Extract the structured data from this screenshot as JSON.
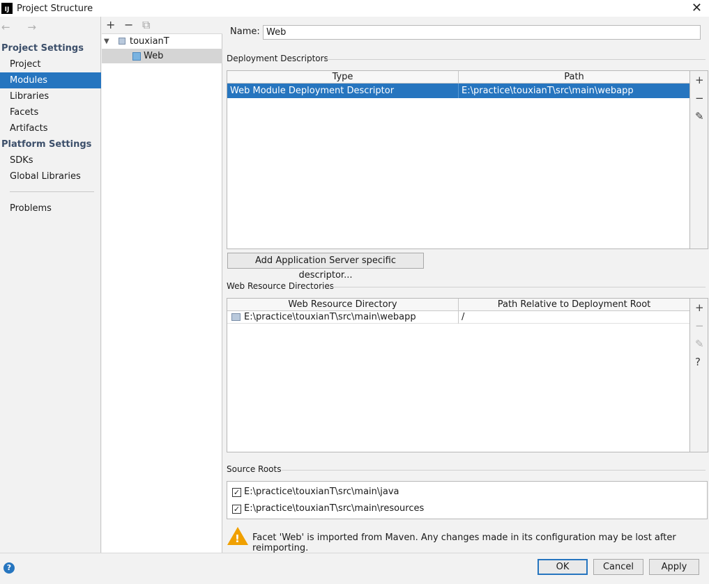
{
  "window": {
    "title": "Project Structure",
    "app_icon": "IJ"
  },
  "nav": {
    "back_forward": "← →",
    "project_settings_header": "Project Settings",
    "project_settings_items": [
      "Project",
      "Modules",
      "Libraries",
      "Facets",
      "Artifacts"
    ],
    "selected_item": "Modules",
    "platform_settings_header": "Platform Settings",
    "platform_settings_items": [
      "SDKs",
      "Global Libraries"
    ],
    "problems": "Problems"
  },
  "tree": {
    "toolbar": {
      "add": "+",
      "remove": "−",
      "copy": "⧉"
    },
    "root": "touxianT",
    "child": "Web"
  },
  "module": {
    "name_label": "Name:",
    "name_value": "Web",
    "deployment_descriptors_title": "Deployment Descriptors",
    "dd_columns": [
      "Type",
      "Path"
    ],
    "dd_rows": [
      [
        "Web Module Deployment Descriptor",
        "E:\\practice\\touxianT\\src\\main\\webapp"
      ]
    ],
    "add_server_descriptor_button": "Add Application Server specific descriptor...",
    "web_resource_title": "Web Resource Directories",
    "wr_columns": [
      "Web Resource Directory",
      "Path Relative to Deployment Root"
    ],
    "wr_rows": [
      [
        "E:\\practice\\touxianT\\src\\main\\webapp",
        "/"
      ]
    ],
    "source_roots_title": "Source Roots",
    "source_roots": [
      {
        "path": "E:\\practice\\touxianT\\src\\main\\java",
        "checked": true
      },
      {
        "path": "E:\\practice\\touxianT\\src\\main\\resources",
        "checked": true
      }
    ],
    "warning": "Facet 'Web' is imported from Maven. Any changes made in its configuration may be lost after reimporting."
  },
  "side_buttons": {
    "add": "+",
    "remove": "−",
    "edit": "✎",
    "help": "?"
  },
  "footer": {
    "help": "?",
    "ok": "OK",
    "cancel": "Cancel",
    "apply": "Apply"
  },
  "colors": {
    "selection": "#2675bf",
    "section_header": "#3c4f6a",
    "warning": "#f0a000"
  }
}
